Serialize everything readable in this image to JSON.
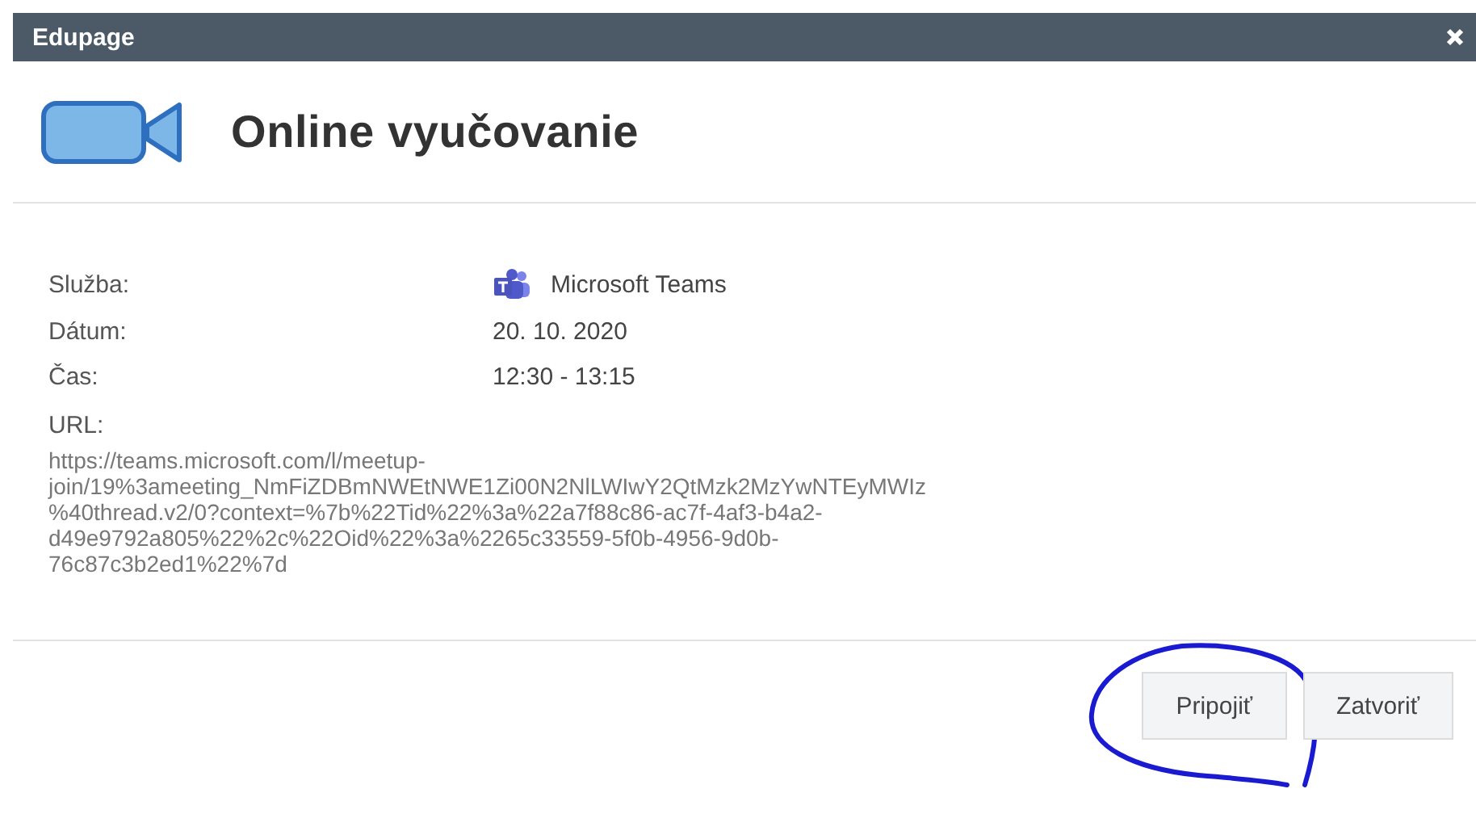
{
  "window": {
    "title": "Edupage"
  },
  "header": {
    "title": "Online vyučovanie"
  },
  "fields": [
    {
      "label": "Služba:",
      "value": "Microsoft Teams",
      "kind": "service"
    },
    {
      "label": "Dátum:",
      "value": "20. 10. 2020",
      "kind": "text"
    },
    {
      "label": "Čas:",
      "value": "12:30 - 13:15",
      "kind": "text"
    }
  ],
  "url": {
    "label": "URL:",
    "value": "https://teams.microsoft.com/l/meetup-\njoin/19%3ameeting_NmFiZDBmNWEtNWE1Zi00N2NlLWIwY2QtMzk2MzYwNTEyMWIz\n%40thread.v2/0?context=%7b%22Tid%22%3a%22a7f88c86-ac7f-4af3-b4a2-\nd49e9792a805%22%2c%22Oid%22%3a%2265c33559-5f0b-4956-9d0b-\n76c87c3b2ed1%22%7d"
  },
  "buttons": [
    "Pripojiť",
    "Zatvoriť"
  ]
}
